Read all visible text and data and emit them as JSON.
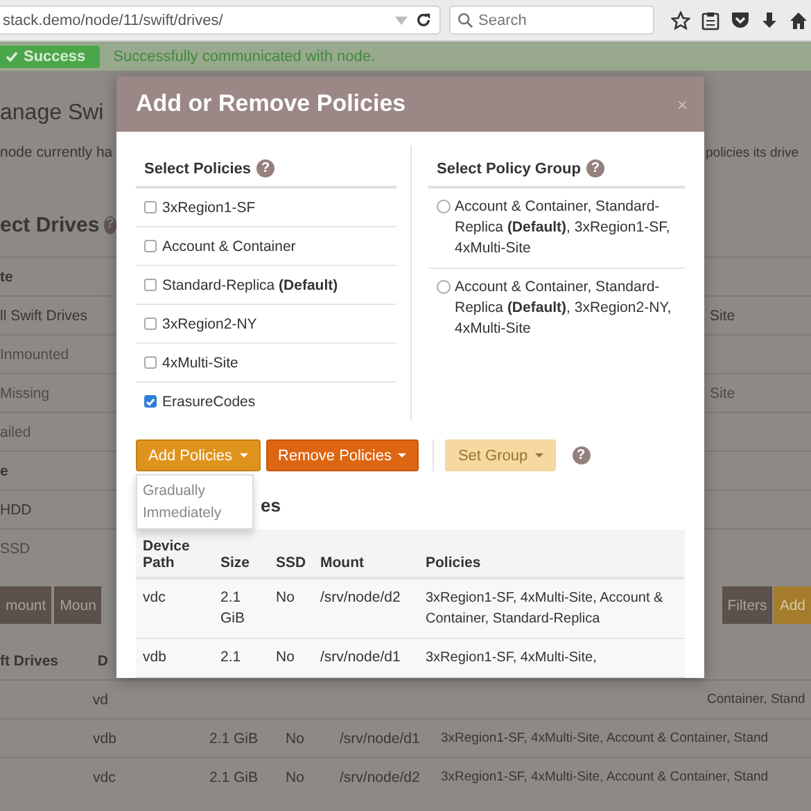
{
  "browser": {
    "url": "stack.demo/node/11/swift/drives/",
    "search": {
      "placeholder": "Search"
    }
  },
  "alert": {
    "badge": "Success",
    "message": "Successfully communicated with node."
  },
  "page": {
    "title": "anage Swi",
    "intro": "node currently ha",
    "intro_right": "policies its drive",
    "section_title": "ect Drives",
    "help": "?",
    "filters": [
      {
        "label": "te",
        "kind": "heading",
        "disabled": false
      },
      {
        "label": "ll Swift Drives",
        "kind": "item",
        "disabled": false,
        "aside": "Site"
      },
      {
        "label": "Inmounted",
        "kind": "item",
        "disabled": true
      },
      {
        "label": "Missing",
        "kind": "item",
        "disabled": true,
        "aside": "Site"
      },
      {
        "label": "ailed",
        "kind": "item",
        "disabled": true
      },
      {
        "label": "e",
        "kind": "heading",
        "disabled": false
      },
      {
        "label": "HDD",
        "kind": "item",
        "disabled": false
      },
      {
        "label": "SSD",
        "kind": "item",
        "disabled": true
      }
    ],
    "toolbar_left": [
      "mount",
      "Moun"
    ],
    "toolbar_right": [
      {
        "label": "Filters",
        "kind": "dark"
      },
      {
        "label": "Add",
        "kind": "primary"
      }
    ],
    "table": {
      "header_left": "ft Drives",
      "header_col": "D",
      "partial_row": {
        "device": "vd",
        "policies": "Container, Stand"
      },
      "rows": [
        {
          "device": "vdb",
          "size": "2.1 GiB",
          "ssd": "No",
          "mount": "/srv/node/d1",
          "policies": "3xRegion1-SF, 4xMulti-Site, Account & Container, Stand"
        },
        {
          "device": "vdc",
          "size": "2.1 GiB",
          "ssd": "No",
          "mount": "/srv/node/d2",
          "policies": "3xRegion1-SF, 4xMulti-Site, Account & Container, Stand"
        }
      ]
    }
  },
  "modal": {
    "title": "Add or Remove Policies",
    "close": "×",
    "help": "?",
    "policies": {
      "heading": "Select Policies",
      "items": [
        {
          "label": "3xRegion1-SF",
          "checked": false
        },
        {
          "label": "Account & Container",
          "checked": false
        },
        {
          "label": "Standard-Replica **(Default)**",
          "checked": false
        },
        {
          "label": "3xRegion2-NY",
          "checked": false
        },
        {
          "label": "4xMulti-Site",
          "checked": false
        },
        {
          "label": "ErasureCodes",
          "checked": true
        }
      ]
    },
    "policy_groups": {
      "heading": "Select Policy Group",
      "items": [
        {
          "label": "Account & Container, Standard-Replica **(Default)**, 3xRegion1-SF, 4xMulti-Site",
          "selected": false
        },
        {
          "label": "Account & Container, Standard-Replica **(Default)**, 3xRegion2-NY, 4xMulti-Site",
          "selected": false
        }
      ]
    },
    "actions": {
      "add": "Add Policies",
      "remove": "Remove Policies",
      "set_group": {
        "label": "Set Group",
        "disabled": true
      }
    },
    "add_menu": [
      "Gradually",
      "Immediately"
    ],
    "drives_heading": "es",
    "table": {
      "columns": [
        "Device Path",
        "Size",
        "SSD",
        "Mount",
        "Policies"
      ],
      "rows": [
        {
          "cells": [
            "vdc",
            "2.1 GiB",
            "No",
            "/srv/node/d2",
            "3xRegion1-SF, 4xMulti-Site, Account & Container, Standard-Replica"
          ]
        },
        {
          "cells": [
            "vdb",
            "2.1",
            "No",
            "/srv/node/d1",
            "3xRegion1-SF, 4xMulti-Site,"
          ]
        }
      ]
    }
  }
}
